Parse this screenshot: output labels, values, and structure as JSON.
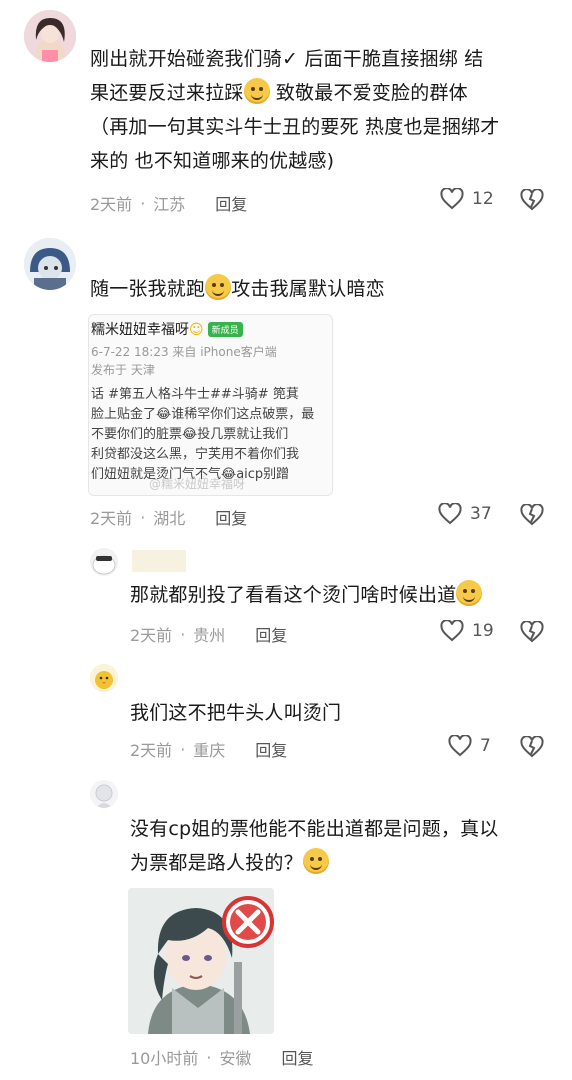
{
  "comments": [
    {
      "lines": [
        "刚出就开始碰瓷我们骑✓ 后面干脆直接捆绑 结",
        "果还要反过来拉踩",
        " 致敬最不爱变脸的群体",
        "（再加一句其实斗牛士丑的要死 热度也是捆绑才",
        "来的 也不知道哪来的优越感)"
      ],
      "time": "2天前",
      "location": "江苏",
      "reply": "回复",
      "likes": "12"
    },
    {
      "lines": [
        "随一张我就跑",
        "攻击我属默认暗恋"
      ],
      "time": "2天前",
      "location": "湖北",
      "reply": "回复",
      "likes": "37",
      "image": {
        "line1": "糯米妞妞幸福呀",
        "badge": "新成员",
        "line2": "6-7-22 18:23  来自 iPhone客户端",
        "line3": "发布于 天津",
        "line4": "话 #第五人格斗牛士##斗骑# 篼萁",
        "line5": "脸上贴金了😂谁稀罕你们这点破票，最",
        "line6": "不要你们的脏票😂投几票就让我们",
        "line7": "利贷都没这么黑，宁芙用不着你们我",
        "line8": "们妞妞就是烫门气不气😂aicp别蹭",
        "watermark": "@糯米妞妞幸福呀"
      }
    },
    {
      "lines": [
        "那就都别投了看看这个烫门啥时候出道"
      ],
      "time": "2天前",
      "location": "贵州",
      "reply": "回复",
      "likes": "19"
    },
    {
      "lines": [
        "我们这不把牛头人叫烫门"
      ],
      "time": "2天前",
      "location": "重庆",
      "reply": "回复",
      "likes": "7"
    },
    {
      "lines": [
        "没有cp姐的票他能不能出道都是问题，真以",
        "为票都是路人投的？"
      ],
      "time": "10小时前",
      "location": "安徽",
      "reply": "回复"
    }
  ],
  "separator": "·"
}
